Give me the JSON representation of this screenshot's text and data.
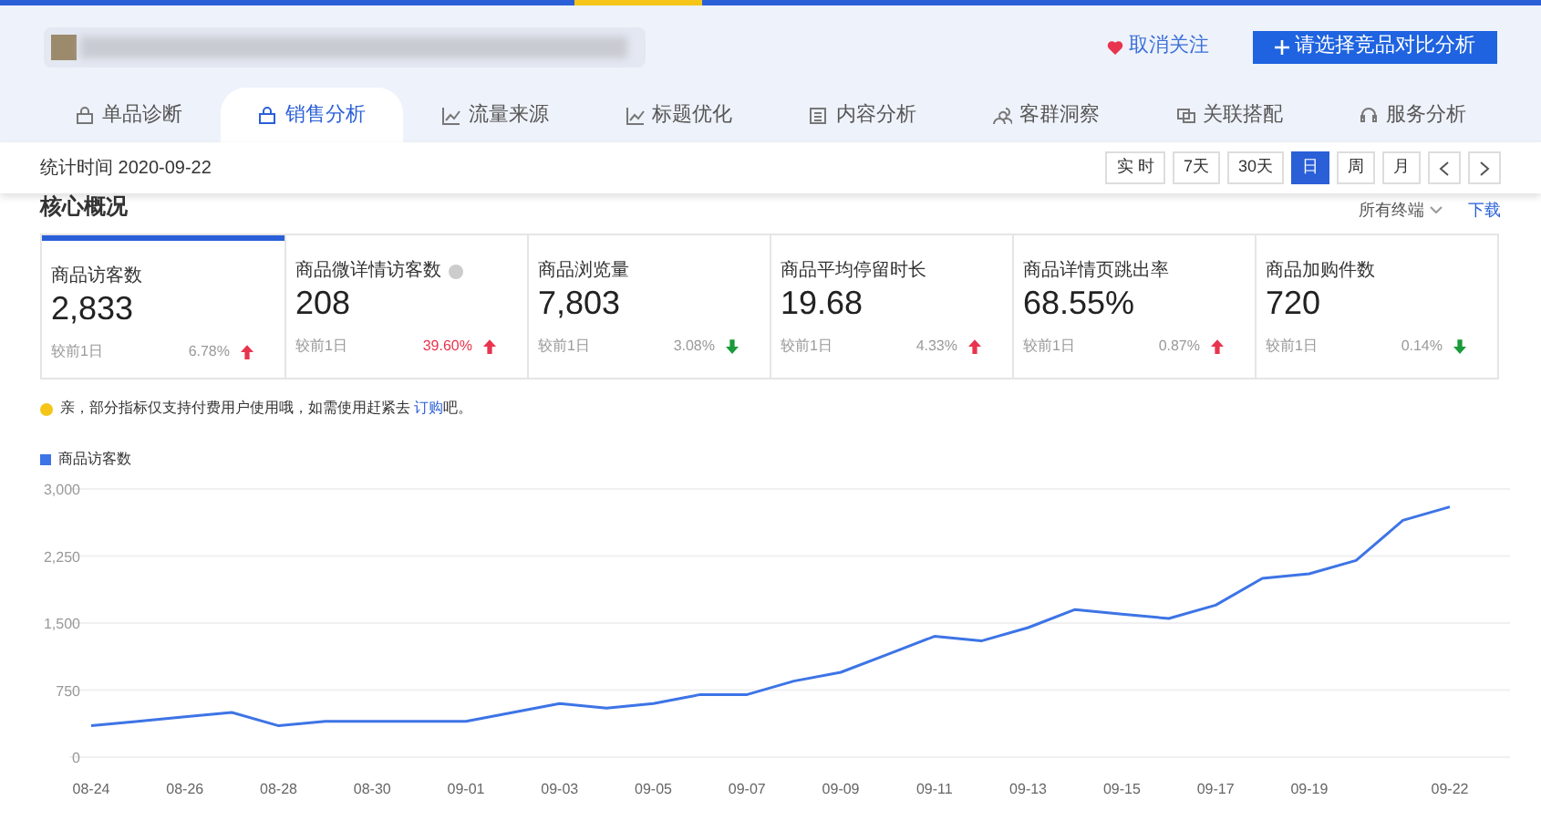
{
  "header": {
    "unfollow": "取消关注",
    "compare_button": "请选择竞品对比分析"
  },
  "tabs": [
    {
      "label": "单品诊断",
      "selected": false
    },
    {
      "label": "销售分析",
      "selected": true
    },
    {
      "label": "流量来源",
      "selected": false
    },
    {
      "label": "标题优化",
      "selected": false
    },
    {
      "label": "内容分析",
      "selected": false
    },
    {
      "label": "客群洞察",
      "selected": false
    },
    {
      "label": "关联搭配",
      "selected": false
    },
    {
      "label": "服务分析",
      "selected": false
    }
  ],
  "date_bar": {
    "label": "统计时间 2020-09-22",
    "ranges": [
      {
        "label": "实 时",
        "selected": false
      },
      {
        "label": "7天",
        "selected": false
      },
      {
        "label": "30天",
        "selected": false
      },
      {
        "label": "日",
        "selected": true
      },
      {
        "label": "周",
        "selected": false
      },
      {
        "label": "月",
        "selected": false
      }
    ]
  },
  "section": {
    "title": "核心概况",
    "terminal": "所有终端",
    "download": "下载"
  },
  "cards": [
    {
      "label": "商品访客数",
      "value": "2,833",
      "compare": "较前1日",
      "change": "6.78%",
      "rising": true,
      "highlight": false,
      "info": false,
      "selected": true
    },
    {
      "label": "商品微详情访客数",
      "value": "208",
      "compare": "较前1日",
      "change": "39.60%",
      "rising": true,
      "highlight": true,
      "info": true,
      "selected": false
    },
    {
      "label": "商品浏览量",
      "value": "7,803",
      "compare": "较前1日",
      "change": "3.08%",
      "rising": false,
      "highlight": false,
      "info": false,
      "selected": false
    },
    {
      "label": "商品平均停留时长",
      "value": "19.68",
      "compare": "较前1日",
      "change": "4.33%",
      "rising": true,
      "highlight": false,
      "info": false,
      "selected": false
    },
    {
      "label": "商品详情页跳出率",
      "value": "68.55%",
      "compare": "较前1日",
      "change": "0.87%",
      "rising": true,
      "highlight": false,
      "info": false,
      "selected": false
    },
    {
      "label": "商品加购件数",
      "value": "720",
      "compare": "较前1日",
      "change": "0.14%",
      "rising": false,
      "highlight": false,
      "info": false,
      "selected": false
    }
  ],
  "notice": {
    "text": "亲，部分指标仅支持付费用户使用哦，如需使用赶紧去",
    "link": "订购",
    "after": "吧。"
  },
  "chart_data": {
    "type": "line",
    "categories": [
      "08-24",
      null,
      "08-26",
      null,
      "08-28",
      null,
      "08-30",
      null,
      "09-01",
      null,
      "09-03",
      null,
      "09-05",
      null,
      "09-07",
      null,
      "09-09",
      null,
      "09-11",
      null,
      "09-13",
      null,
      "09-15",
      null,
      "09-17",
      null,
      "09-19",
      null,
      null,
      "09-22"
    ],
    "series": [
      {
        "name": "商品访客数",
        "color": "#3d74e6",
        "values": [
          350,
          400,
          450,
          500,
          350,
          400,
          400,
          400,
          400,
          500,
          600,
          550,
          600,
          700,
          700,
          850,
          950,
          1150,
          1350,
          1300,
          1450,
          1650,
          1600,
          1550,
          1700,
          2000,
          2050,
          2200,
          2650,
          2800
        ]
      }
    ],
    "ylim": [
      0,
      3000
    ],
    "grid": true,
    "yticks": [
      {
        "value": 0,
        "label": "0"
      },
      {
        "value": 750,
        "label": "750"
      },
      {
        "value": 1500,
        "label": "1,500"
      },
      {
        "value": 2250,
        "label": "2,250"
      },
      {
        "value": 3000,
        "label": "3,000"
      }
    ]
  }
}
